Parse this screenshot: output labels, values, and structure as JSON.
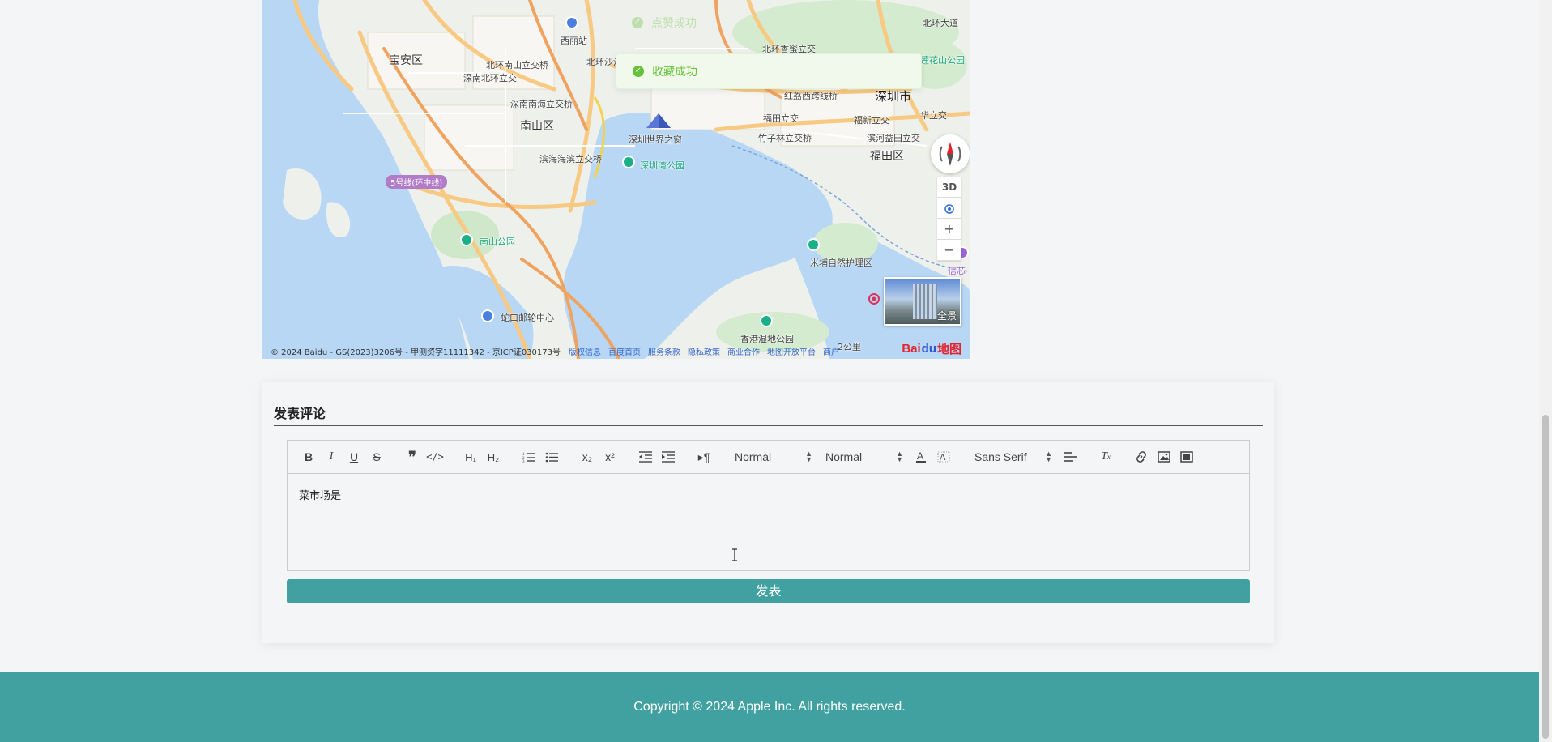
{
  "map": {
    "labels": {
      "baoan": "宝安区",
      "nanshan": "南山区",
      "futian": "福田区",
      "shenzhen": "深圳市",
      "xili_station": "西丽站",
      "beihuan_nanshan": "北环南山立交桥",
      "shennan_beihuan": "深南北环立交",
      "shennan_nanhai": "深南南海立交桥",
      "binhai_binhai": "滨海海滨立交桥",
      "window_world": "深圳世界之窗",
      "shenzhen_bay_park": "深圳湾公园",
      "nanshan_park": "南山公园",
      "shekou_ship": "蛇口邮轮中心",
      "hk_wetland": "香港湿地公园",
      "mipu": "米埔自然护理区",
      "beihuan_xiangmi": "北环香蜜立交",
      "hongli_xi": "红荔西跨线桥",
      "futian_interchange": "福田立交",
      "zhuzilin": "竹子林立交桥",
      "huaxin": "福新立交",
      "binhe_yitian": "滨河益田立交",
      "huahua": "华立交",
      "beihuan_road": "北环大道",
      "lianhua": "莲花山公园",
      "metro_line": "5号线(环中线)",
      "beihuan_sha": "北环沙河",
      "distance": "2公里",
      "xinxin": "信芯"
    },
    "controls": {
      "three_d": "3D",
      "zoom_in": "+",
      "zoom_out": "−",
      "panorama": "全景"
    },
    "footer": {
      "copyright": "© 2024 Baidu - GS(2023)3206号 - 甲测资字11111342 - 京ICP证030173号",
      "links": [
        "版权信息",
        "百度首页",
        "服务条款",
        "隐私政策",
        "商业合作",
        "地图开放平台",
        "商户"
      ],
      "logo_left": "Bai",
      "logo_mid": "du",
      "logo_right": "地图"
    }
  },
  "toast": {
    "message": "收藏成功",
    "ghost_message": "点赞成功"
  },
  "comment": {
    "title": "发表评论",
    "content": "菜市场是",
    "submit_label": "发表",
    "toolbar": {
      "header_select": "Normal",
      "size_select": "Normal",
      "font_select": "Sans Serif"
    }
  },
  "footer": {
    "copyright": "Copyright © 2024 Apple Inc. All rights reserved."
  },
  "colors": {
    "accent": "#41a0a0",
    "success": "#67c23a"
  }
}
